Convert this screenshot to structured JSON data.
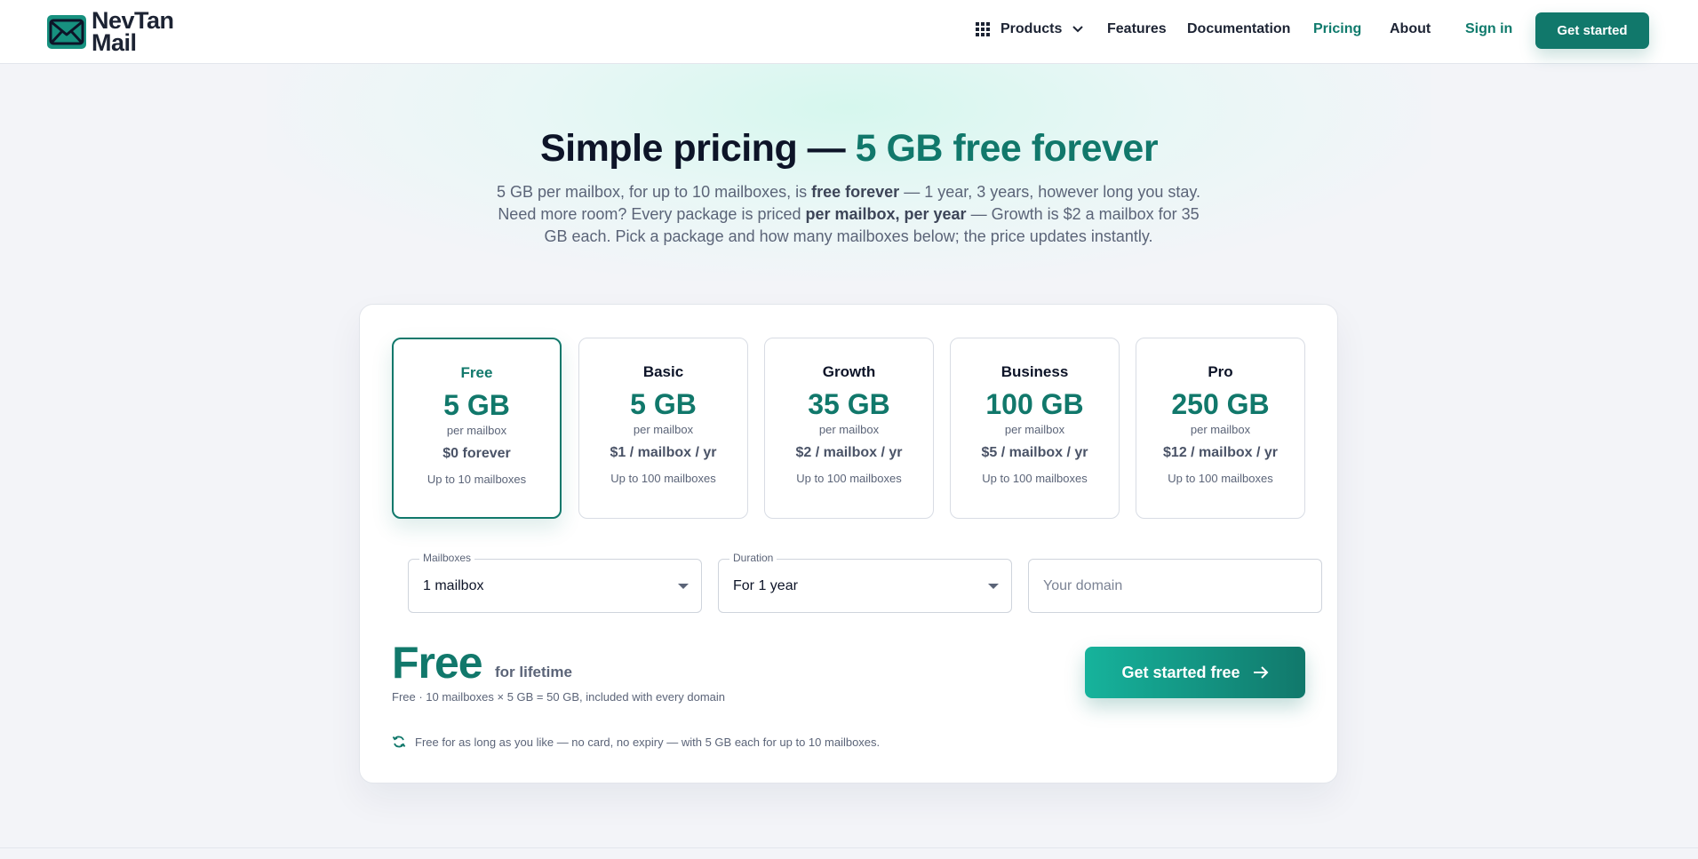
{
  "brand": {
    "name_line1": "NevTan",
    "name_line2": "Mail"
  },
  "nav": {
    "products": "Products",
    "features": "Features",
    "documentation": "Documentation",
    "pricing": "Pricing",
    "about": "About",
    "sign_in": "Sign in",
    "get_started": "Get started"
  },
  "hero": {
    "title_main": "Simple pricing —",
    "title_accent": "5 GB free forever",
    "sub_1": "5 GB per mailbox, for up to 10 mailboxes, is ",
    "sub_1_bold": "free forever",
    "sub_2": " — 1 year, 3 years, however long you stay. Need more room? Every package is priced ",
    "sub_2_bold": "per mailbox, per year",
    "sub_3": " — Growth is $2 a mailbox for 35 GB each. Pick a package and how many mailboxes below; the price updates instantly."
  },
  "plans": [
    {
      "name": "Free",
      "size": "5 GB",
      "per": "per mailbox",
      "price": "$0 forever",
      "limit": "Up to 10 mailboxes",
      "selected": true
    },
    {
      "name": "Basic",
      "size": "5 GB",
      "per": "per mailbox",
      "price": "$1 / mailbox / yr",
      "limit": "Up to 100 mailboxes",
      "selected": false
    },
    {
      "name": "Growth",
      "size": "35 GB",
      "per": "per mailbox",
      "price": "$2 / mailbox / yr",
      "limit": "Up to 100 mailboxes",
      "selected": false
    },
    {
      "name": "Business",
      "size": "100 GB",
      "per": "per mailbox",
      "price": "$5 / mailbox / yr",
      "limit": "Up to 100 mailboxes",
      "selected": false
    },
    {
      "name": "Pro",
      "size": "250 GB",
      "per": "per mailbox",
      "price": "$12 / mailbox / yr",
      "limit": "Up to 100 mailboxes",
      "selected": false
    }
  ],
  "form": {
    "mailboxes_label": "Mailboxes",
    "mailboxes_value": "1 mailbox",
    "duration_label": "Duration",
    "duration_value": "For 1 year",
    "domain_placeholder": "Your domain"
  },
  "summary": {
    "price": "Free",
    "suffix": "for lifetime",
    "detail": "Free · 10 mailboxes × 5 GB = 50 GB, included with every domain",
    "note": "Free for as long as you like — no card, no expiry — with 5 GB each for up to 10 mailboxes.",
    "cta": "Get started free"
  },
  "colors": {
    "accent": "#11786b",
    "accent_light": "#16b39c"
  },
  "icons": {
    "logo": "envelope-icon",
    "products": "grid-icon",
    "products_caret": "chevron-down-icon",
    "note": "sync-icon",
    "cta": "arrow-right-icon"
  }
}
